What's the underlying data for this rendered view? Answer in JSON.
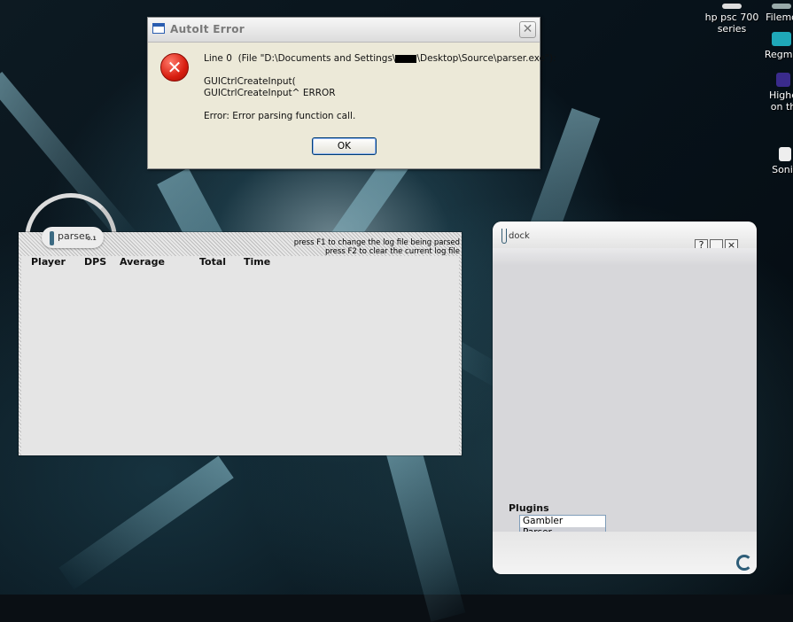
{
  "desktop": {
    "icons": [
      {
        "label": "Filemo"
      },
      {
        "label": "hp psc 700 series"
      },
      {
        "label": "Regmo"
      },
      {
        "label": "Highe on th"
      },
      {
        "label": "Sonic"
      }
    ]
  },
  "dialog": {
    "title": "AutoIt Error",
    "close_label": "✕",
    "line1_prefix": "Line 0  (File \"D:\\Documents and Settings\\",
    "line1_suffix": "\\Desktop\\Source\\parser.exe\"):",
    "code_line1": "GUICtrlCreateInput(",
    "code_line2": "GUICtrlCreateInput^ ERROR",
    "error_message": "Error: Error parsing function call.",
    "ok_label": "OK"
  },
  "parser": {
    "name": "parser",
    "version": "0.1",
    "hint1": "press F1 to change the log file being parsed",
    "hint2": "press F2 to clear the current log file",
    "columns": [
      "Player",
      "DPS",
      "Average",
      "Total",
      "Time"
    ]
  },
  "dock": {
    "title": "dock",
    "help_label": "?",
    "minimize_label": "_",
    "close_label": "×",
    "plugins_label": "Plugins",
    "plugins": [
      {
        "label": "Gambler",
        "selected": false
      },
      {
        "label": "Parser",
        "selected": true
      }
    ]
  }
}
